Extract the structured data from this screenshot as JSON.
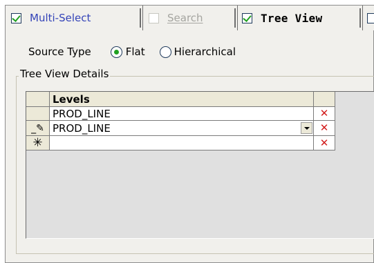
{
  "tabs": [
    {
      "label": "Multi-Select",
      "checked": true,
      "enabled": true,
      "active": false
    },
    {
      "label": "Search",
      "checked": false,
      "enabled": false,
      "active": false
    },
    {
      "label": "Tree View",
      "checked": true,
      "enabled": true,
      "active": true
    }
  ],
  "source_type": {
    "label": "Source Type",
    "options": [
      {
        "label": "Flat",
        "selected": true
      },
      {
        "label": "Hierarchical",
        "selected": false
      }
    ]
  },
  "group": {
    "title": "Tree View Details"
  },
  "grid": {
    "header": "Levels",
    "rows": [
      {
        "value": "PROD_LINE",
        "marker": "",
        "editing": false
      },
      {
        "value": "PROD_LINE",
        "marker": "pencil",
        "editing": true
      },
      {
        "value": "",
        "marker": "*",
        "editing": false
      }
    ]
  },
  "icons": {
    "delete": "close-icon",
    "edit": "pencil-icon",
    "new_row": "asterisk-icon",
    "dropdown": "chevron-down-icon"
  },
  "colors": {
    "accent_check": "#21a121",
    "delete_red": "#d21d1d",
    "tab_blue": "#3343b8",
    "panel_bg": "#f1f0ec"
  }
}
